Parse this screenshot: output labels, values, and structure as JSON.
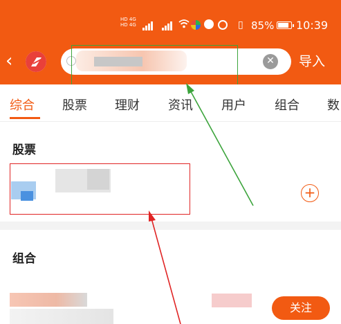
{
  "status_bar": {
    "network_labels": [
      "HD 4G",
      "HD 4G"
    ],
    "battery": "85%",
    "time": "10:39",
    "icons": [
      "signal-icon",
      "wifi-icon",
      "app-icon",
      "vibrate-icon",
      "battery-icon"
    ]
  },
  "header": {
    "back_icon": "chevron-left-icon",
    "logo_icon": "app-logo-icon",
    "search": {
      "query": "",
      "clear_icon": "clear-icon",
      "search_icon": "search-icon"
    },
    "import_label": "导入",
    "accent_color": "#f25a12"
  },
  "tabs": [
    {
      "label": "综合",
      "active": true
    },
    {
      "label": "股票",
      "active": false
    },
    {
      "label": "理财",
      "active": false
    },
    {
      "label": "资讯",
      "active": false
    },
    {
      "label": "用户",
      "active": false
    },
    {
      "label": "组合",
      "active": false
    },
    {
      "label": "数",
      "active": false
    }
  ],
  "sections": {
    "stocks_title": "股票",
    "portfolio_title": "组合",
    "add_icon": "plus-circle-icon",
    "follow_label": "关注"
  },
  "annotations": {
    "green_color": "#3ca43c",
    "red_color": "#e02424"
  }
}
